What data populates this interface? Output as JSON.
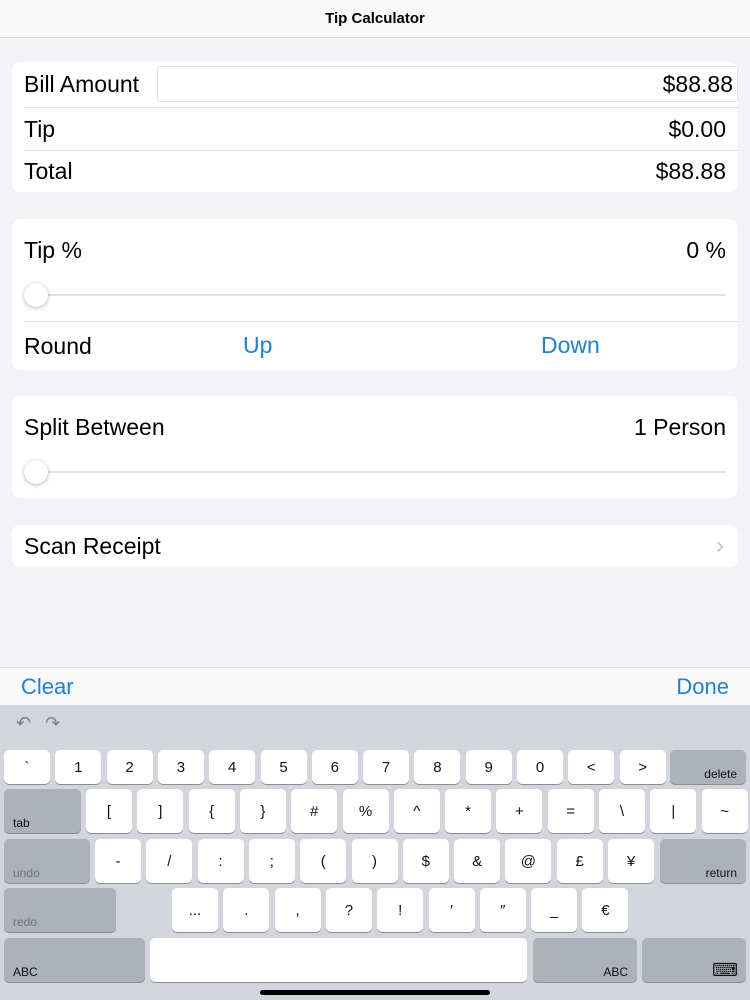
{
  "nav": {
    "title": "Tip Calculator"
  },
  "summary": {
    "bill_label": "Bill Amount",
    "bill_value": "$88.88",
    "tip_label": "Tip",
    "tip_value": "$0.00",
    "total_label": "Total",
    "total_value": "$88.88"
  },
  "tip_card": {
    "label": "Tip %",
    "value": "0 %",
    "slider_fraction": 0,
    "round_label": "Round",
    "up_label": "Up",
    "down_label": "Down"
  },
  "split_card": {
    "label": "Split Between",
    "value": "1 Person",
    "slider_fraction": 0
  },
  "scan": {
    "label": "Scan Receipt",
    "chevron": "›"
  },
  "accessory": {
    "clear_label": "Clear",
    "done_label": "Done"
  },
  "keyboard": {
    "undo_icon": "↶",
    "redo_icon": "↷",
    "row1": [
      "`",
      "1",
      "2",
      "3",
      "4",
      "5",
      "6",
      "7",
      "8",
      "9",
      "0",
      "<",
      ">"
    ],
    "delete_label": "delete",
    "tab_label": "tab",
    "row2": [
      "[",
      "]",
      "{",
      "}",
      "#",
      "%",
      "^",
      "*",
      "+",
      "=",
      "\\",
      "|",
      "~"
    ],
    "undo_label": "undo",
    "row3": [
      "-",
      "/",
      ":",
      ";",
      "(",
      ")",
      "$",
      "&",
      "@",
      "£",
      "¥"
    ],
    "return_label": "return",
    "redo_label": "redo",
    "row4": [
      "...",
      ".",
      ",",
      "?",
      "!",
      "′",
      "″",
      "_",
      "€"
    ],
    "abc_label": "ABC",
    "keyboard_icon": "⌨"
  },
  "colors": {
    "accent": "#1a82d8",
    "background": "#f2f2f7"
  }
}
